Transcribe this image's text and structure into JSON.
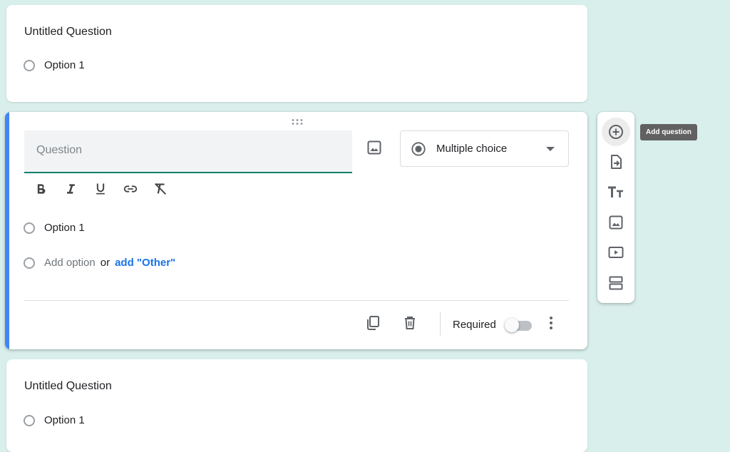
{
  "cards": [
    {
      "title": "Untitled Question",
      "options": [
        "Option 1"
      ]
    },
    {
      "title": "Untitled Question",
      "options": [
        "Option 1"
      ]
    }
  ],
  "active_question": {
    "placeholder": "Question",
    "type_label": "Multiple choice",
    "options": [
      "Option 1"
    ],
    "add_option": "Add option",
    "or_text": "or",
    "add_other": "add \"Other\"",
    "required_label": "Required",
    "required_on": false,
    "accent_color": "#4285f4",
    "underline_color": "#137f6b"
  },
  "format_icons": [
    "bold-icon",
    "italic-icon",
    "underline-icon",
    "link-icon",
    "clear-format-icon"
  ],
  "side_toolbar": {
    "buttons": [
      "add-question-icon",
      "import-questions-icon",
      "add-title-icon",
      "add-image-icon",
      "add-video-icon",
      "add-section-icon"
    ],
    "tooltip": "Add question"
  }
}
